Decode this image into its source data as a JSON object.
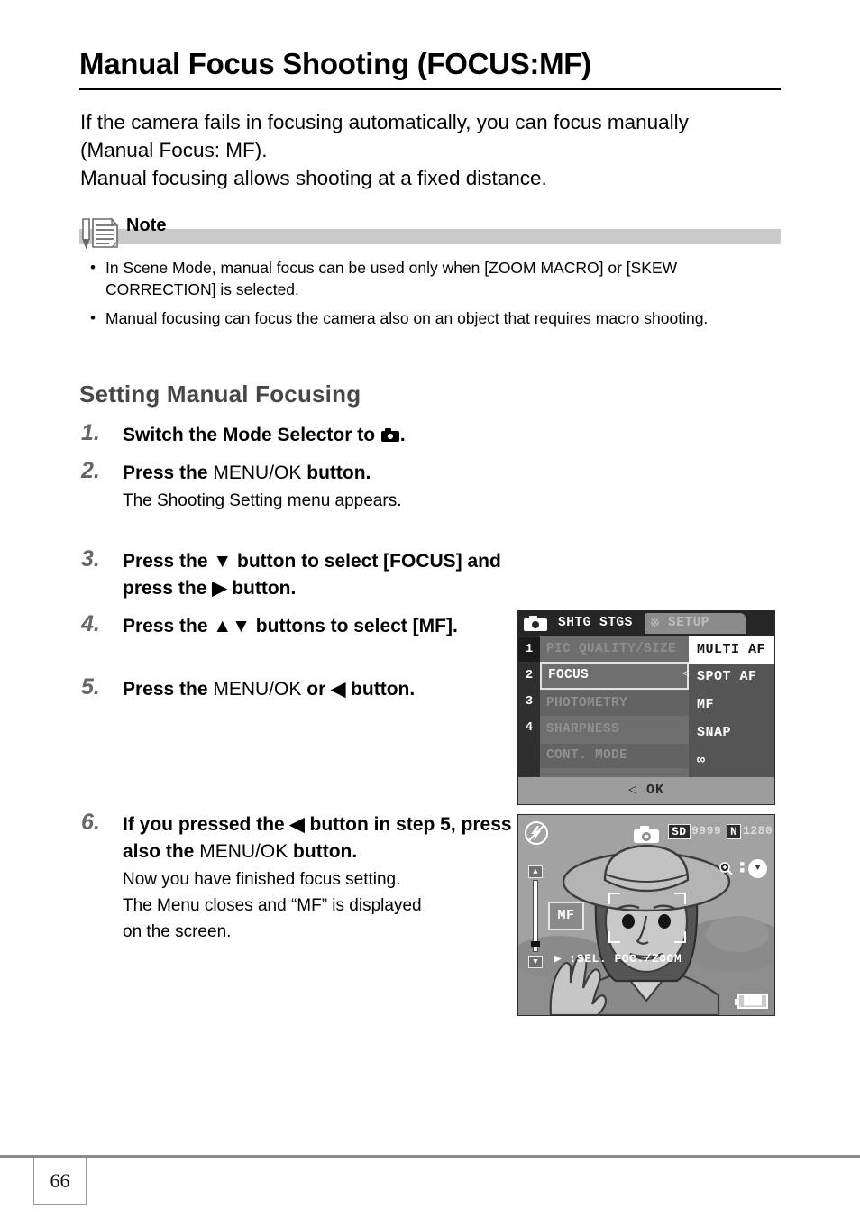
{
  "page": {
    "title": "Manual Focus Shooting (FOCUS:MF)",
    "page_number": "66"
  },
  "intro": {
    "line1": "If the camera fails in focusing automatically, you can focus manually",
    "line2": "(Manual Focus: MF).",
    "line3": "Manual focusing allows shooting at a fixed distance."
  },
  "note": {
    "label": "Note",
    "bullet": "•",
    "items": [
      "In Scene Mode, manual focus can be used only when [ZOOM MACRO] or [SKEW CORRECTION] is selected.",
      "Manual focusing can focus the camera also on an object that requires macro shooting."
    ]
  },
  "section": {
    "heading": "Setting Manual Focusing"
  },
  "steps": [
    {
      "num": "1.",
      "title_pre": "Switch the Mode Selector to ",
      "title_post": ".",
      "sub": ""
    },
    {
      "num": "2.",
      "title_pre": "Press the ",
      "title_mid": "MENU/OK",
      "title_post": " button.",
      "sub": "The Shooting Setting menu appears."
    },
    {
      "num": "3.",
      "title_pre": "Press the ▼ button to select [FOCUS] and press the ▶ button.",
      "sub": ""
    },
    {
      "num": "4.",
      "title_pre": "Press the ▲▼ buttons to select [MF].",
      "sub": ""
    },
    {
      "num": "5.",
      "title_pre": "Press the ",
      "title_mid": "MENU/OK",
      "title_post": " or ◀ button.",
      "sub": ""
    },
    {
      "num": "6.",
      "title_pre": "If you pressed the ◀ button in step 5, press also the ",
      "title_mid": "MENU/OK",
      "title_post": " button.",
      "sub_line1": "Now you have finished focus setting.",
      "sub_line2": "The Menu closes and “MF” is displayed",
      "sub_line3": "on the screen."
    }
  ],
  "lcd_menu": {
    "tab_shooting": "SHTG STGS",
    "tab_setup": "SETUP",
    "numbers": [
      "1",
      "2",
      "3",
      "4"
    ],
    "rows": [
      "PIC QUALITY/SIZE",
      "FOCUS",
      "PHOTOMETRY",
      "SHARPNESS",
      "CONT. MODE"
    ],
    "selected_row": "FOCUS",
    "options": [
      "MULTI AF",
      "SPOT AF",
      "MF",
      "SNAP",
      "∞"
    ],
    "highlighted_option": "MULTI AF",
    "footer": "◁ OK",
    "caret": "◁"
  },
  "lcd_live": {
    "flash_icon": "⚡",
    "indicator_sd": "SD",
    "indicator_shots": "9999",
    "indicator_quality": "N",
    "indicator_size": "1280",
    "zoom_icon": "⊕",
    "down_icon": "▼",
    "mf_badge": "MF",
    "mf_near": "▲",
    "mf_far": "▼",
    "hint": "▶ ↕SEL. FOC./ZOOM",
    "battery": "███"
  },
  "colors": {
    "note_bar": "#c9c9c9",
    "step_number": "#666666",
    "section_heading": "#474747",
    "rule": "#000000",
    "footer_rule": "#8c8c8c"
  }
}
